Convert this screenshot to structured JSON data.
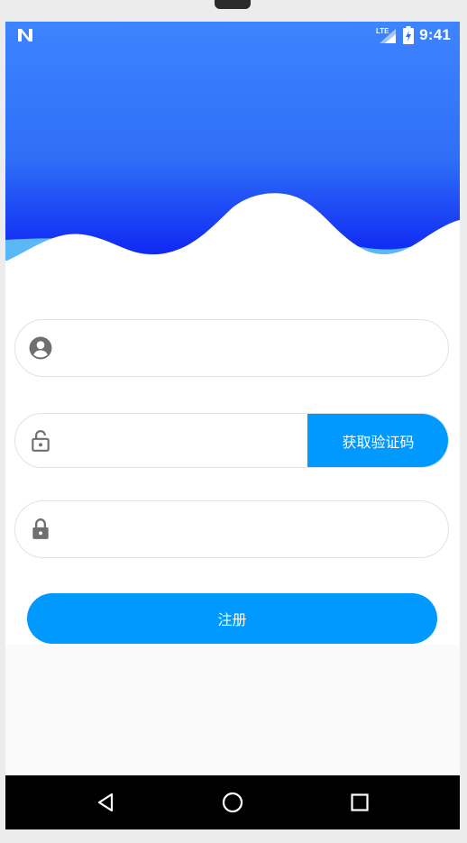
{
  "status_bar": {
    "time": "9:41",
    "network_label": "LTE",
    "left_icon": "n-notification-icon",
    "signal_icon": "signal-icon",
    "battery_icon": "battery-charging-icon"
  },
  "form": {
    "username": {
      "icon": "user-circle-icon",
      "value": "",
      "placeholder": ""
    },
    "code": {
      "icon": "lock-open-icon",
      "value": "",
      "placeholder": "",
      "button_label": "获取验证码"
    },
    "password": {
      "icon": "lock-icon",
      "value": "",
      "placeholder": ""
    },
    "register_label": "注册"
  },
  "navigation": {
    "back_icon": "back-triangle-icon",
    "home_icon": "home-circle-icon",
    "recent_icon": "recent-square-icon"
  },
  "colors": {
    "primary": "#0099ff",
    "header_top": "#3d84ff",
    "header_bottom": "#0a1df2",
    "wave_light": "#5ab8f7",
    "page_background": "#fafafa",
    "nav_bar": "#000000"
  }
}
